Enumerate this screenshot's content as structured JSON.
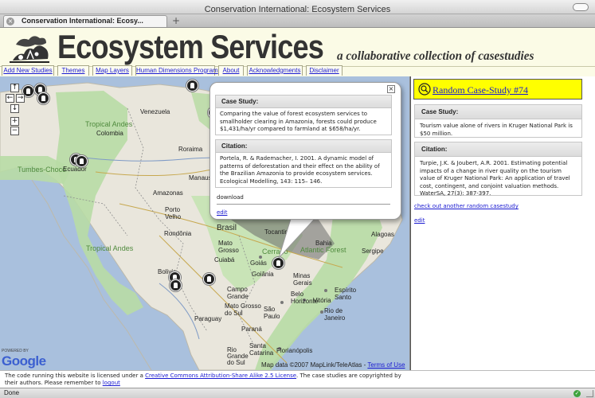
{
  "window": {
    "title": "Conservation International: Ecosystem Services"
  },
  "tabs": [
    {
      "label": "Conservation International: Ecosy..."
    }
  ],
  "header": {
    "title": "Ecosystem Services",
    "tagline": "a collaborative collection of casestudies"
  },
  "nav": {
    "items": [
      {
        "label": "Add New Studies"
      },
      {
        "label": "Themes"
      },
      {
        "label": "Map Layers"
      },
      {
        "label": "Human Dimensions Program"
      },
      {
        "label": "About"
      },
      {
        "label": "Acknowledgments"
      },
      {
        "label": "Disclaimer"
      }
    ]
  },
  "map": {
    "labels": {
      "venezuela": "Venezuela",
      "colombia": "Colombia",
      "tropical_andes": "Tropical Andes",
      "roraima": "Roraima",
      "manaus": "Manaus",
      "amazonas": "Amazonas",
      "porto_velho": "Porto\nVelho",
      "rondonia": "Rondônia",
      "brasil": "Brasil",
      "tumbes": "Tumbes-Chocó",
      "ecuador": "Ecuador",
      "mato_grosso": "Mato\nGrosso",
      "cuiaba": "Cuiabá",
      "tocantins": "Tocantins",
      "bahia": "Bahia",
      "alagoas": "Alagoas",
      "sergipe": "Sergipe",
      "tropical_andes_2": "Tropical Andes",
      "bolivia": "Bolivia",
      "goias": "Goiás",
      "goiania": "Goiânia",
      "minas_gerais": "Minas\nGerais",
      "espirito_santo": "Espírito\nSanto",
      "campo_grande": "Campo\nGrande",
      "mato_grosso_sul": "Mato Grosso\ndo Sul",
      "belo_horizonte": "Belo\nHorizonte",
      "vitoria": "Vitória",
      "sao_paulo": "São\nPaulo",
      "rio_de_janeiro": "Rio de\nJaneiro",
      "paraguay": "Paraguay",
      "parana": "Paraná",
      "santa_catarina": "Santa\nCatarina",
      "florianopolis": "Florianópolis",
      "rio_grande_do_sul": "Rio\nGrande\ndo Sul",
      "atlantic_forest": "Atlantic Forest",
      "cerrado": "Cerrado"
    },
    "powered_by": "POWERED BY",
    "google": "Google",
    "map_data": "Map data ©2007 MapLink/TeleAtlas - ",
    "terms": "Terms of Use"
  },
  "popup": {
    "case_study_header": "Case Study:",
    "case_study_text": "Comparing the value of forest ecosystem services to smallholder clearing in Amazonia, forests could produce $1,431/ha/yr compared to farmland at $658/ha/yr.",
    "citation_header": "Citation:",
    "citation_text": "Portela, R. & Rademacher, I. 2001. A dynamic model of patterns of deforestation and their effect on the ability of the Brazilian Amazonia to provide ecosystem services. Ecological Modelling, 143: 115– 146.",
    "download": "download",
    "edit": "edit",
    "close": "×"
  },
  "panel": {
    "random_title": "Random Case-Study #74",
    "case_study_header": "Case Study:",
    "case_study_text": "Tourism value alone of rivers in Kruger National Park is $50 million.",
    "citation_header": "Citation:",
    "citation_text": "Turpie, J.K. & Joubert, A.R. 2001. Estimating potential impacts of a change in river quality on the tourism value of Kruger National Park: An application of travel cost, contingent, and conjoint valuation methods. WaterSA, 27(3): 387-397.",
    "random_link": "check out another random casestudy",
    "edit": "edit"
  },
  "footer": {
    "text_before": "The code running this website is licensed under a ",
    "license_link": "Creative Commons Attribution-Share Alike 2.5 License",
    "text_middle": ". The case studies are copyrighted by their authors. Please remember to ",
    "logout_link": "logout"
  },
  "status": {
    "text": "Done"
  },
  "colors": {
    "header_bg": "#fbfbe6",
    "random_bg": "#ffff00",
    "link": "#1a1ad0",
    "ocean": "#a9c0dd",
    "land": "#e9e6dc",
    "hotspot": "#b8dba5"
  }
}
